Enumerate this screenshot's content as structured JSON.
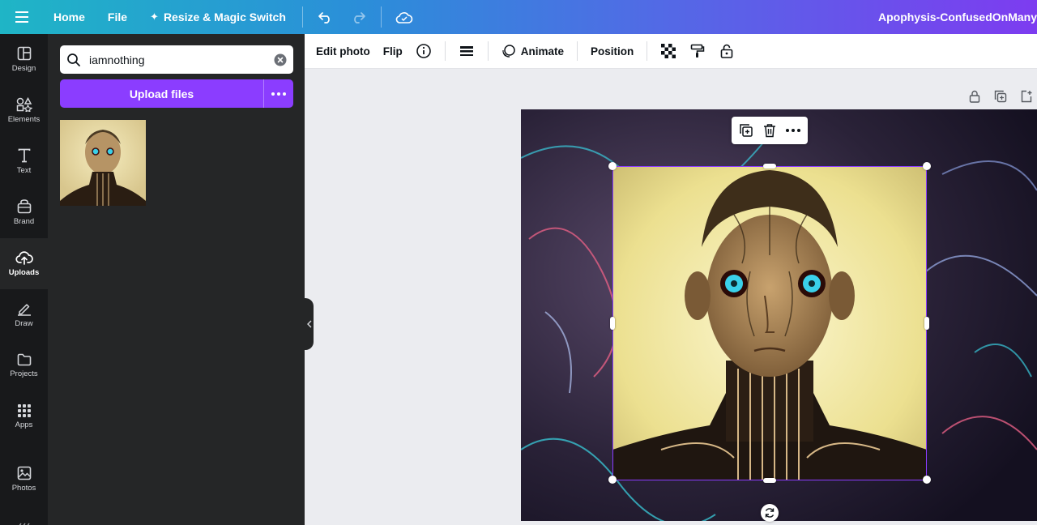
{
  "topbar": {
    "home": "Home",
    "file": "File",
    "resize": "Resize & Magic Switch",
    "design_title": "Apophysis-ConfusedOnMany"
  },
  "rail": {
    "items": [
      {
        "label": "Design",
        "icon": "layout-icon"
      },
      {
        "label": "Elements",
        "icon": "shapes-icon"
      },
      {
        "label": "Text",
        "icon": "text-icon"
      },
      {
        "label": "Brand",
        "icon": "brand-icon"
      },
      {
        "label": "Uploads",
        "icon": "cloud-upload-icon"
      },
      {
        "label": "Draw",
        "icon": "pen-icon"
      },
      {
        "label": "Projects",
        "icon": "folder-icon"
      },
      {
        "label": "Apps",
        "icon": "apps-grid-icon"
      },
      {
        "label": "Photos",
        "icon": "image-icon"
      }
    ]
  },
  "panel": {
    "search_value": "iamnothing",
    "upload_label": "Upload files"
  },
  "toolbar": {
    "edit_photo": "Edit photo",
    "flip": "Flip",
    "animate": "Animate",
    "position": "Position"
  },
  "colors": {
    "accent": "#8b3dff",
    "rail_bg": "#18191b",
    "panel_bg": "#252627"
  }
}
